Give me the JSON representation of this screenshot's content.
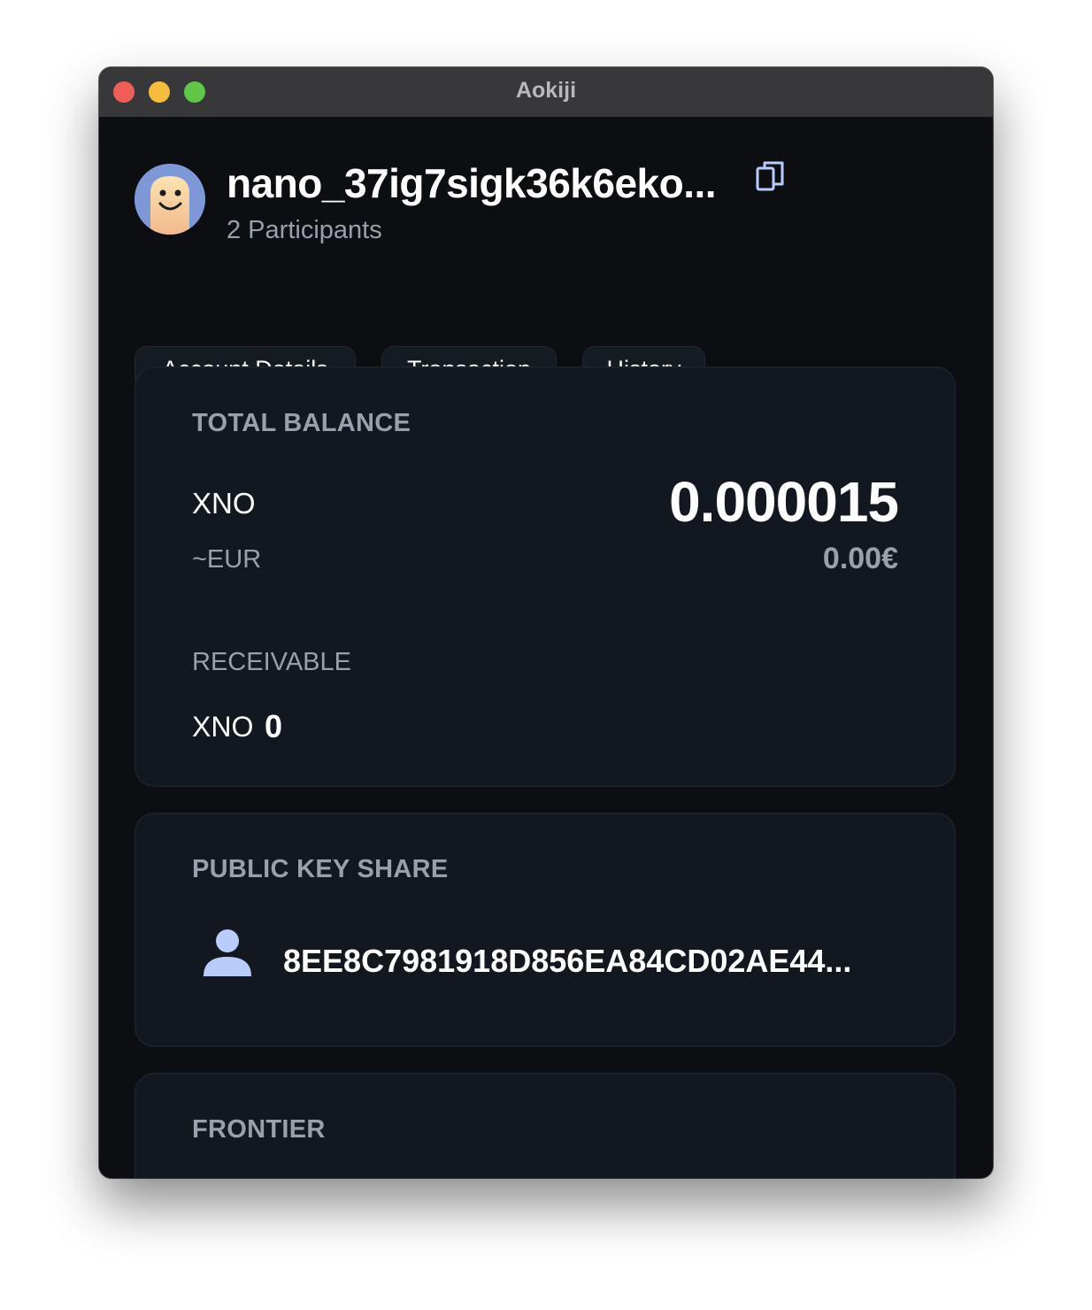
{
  "window": {
    "title": "Aokiji"
  },
  "header": {
    "account_name": "nano_37ig7sigk36k6eko...",
    "participants": "2 Participants",
    "avatar_icon": "smiley-face-avatar",
    "copy_icon": "copy-icon"
  },
  "tabs": [
    {
      "label": "Account Details"
    },
    {
      "label": "Transaction"
    },
    {
      "label": "History"
    }
  ],
  "balance_card": {
    "title": "TOTAL BALANCE",
    "currency": "XNO",
    "amount": "0.000015",
    "fiat_label": "~EUR",
    "fiat_amount": "0.00€",
    "receivable_title": "RECEIVABLE",
    "receivable_currency": "XNO",
    "receivable_amount": "0"
  },
  "public_key_card": {
    "title": "PUBLIC KEY SHARE",
    "user_icon": "user-icon",
    "key": "8EE8C7981918D856EA84CD02AE44..."
  },
  "frontier_card": {
    "title": "FRONTIER"
  },
  "colors": {
    "background": "#0c0e12",
    "card": "#131820",
    "titlebar": "#38383a",
    "text_primary": "#ffffff",
    "text_secondary": "#9aa0ab",
    "accent": "#b8cdfb"
  }
}
